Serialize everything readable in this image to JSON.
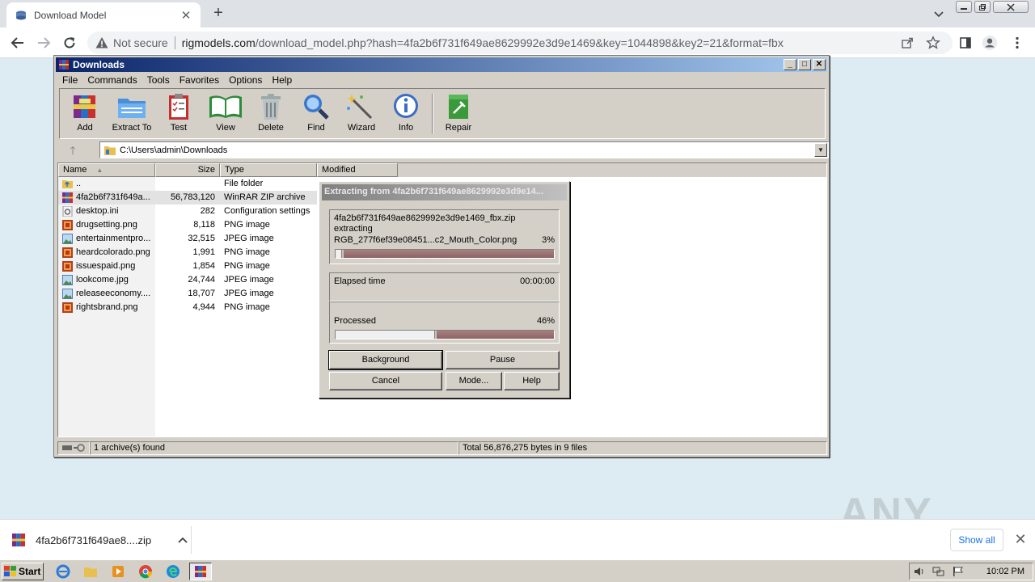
{
  "browser": {
    "tab_title": "Download Model",
    "new_tab": "+",
    "not_secure": "Not secure",
    "url_host": "rigmodels.com",
    "url_path": "/download_model.php?hash=4fa2b6f731f649ae8629992e3d9e1469&key=1044898&key2=21&format=fbx"
  },
  "winrar": {
    "title": "Downloads",
    "menu": [
      "File",
      "Commands",
      "Tools",
      "Favorites",
      "Options",
      "Help"
    ],
    "tools": [
      {
        "label": "Add",
        "icon": "add-archive-icon"
      },
      {
        "label": "Extract To",
        "icon": "extract-folder-icon"
      },
      {
        "label": "Test",
        "icon": "test-clipboard-icon"
      },
      {
        "label": "View",
        "icon": "view-book-icon"
      },
      {
        "label": "Delete",
        "icon": "trash-icon"
      },
      {
        "label": "Find",
        "icon": "magnifier-icon"
      },
      {
        "label": "Wizard",
        "icon": "magic-wand-icon"
      },
      {
        "label": "Info",
        "icon": "info-icon"
      },
      {
        "label": "Repair",
        "icon": "repair-kit-icon"
      }
    ],
    "path": "C:\\Users\\admin\\Downloads",
    "columns": {
      "name": "Name",
      "size": "Size",
      "type": "Type",
      "modified": "Modified"
    },
    "files": [
      {
        "name": "..",
        "size": "",
        "type": "File folder",
        "icon": "parent-folder-icon"
      },
      {
        "name": "4fa2b6f731f649a...",
        "size": "56,783,120",
        "type": "WinRAR ZIP archive",
        "icon": "zip-archive-icon"
      },
      {
        "name": "desktop.ini",
        "size": "282",
        "type": "Configuration settings",
        "icon": "settings-file-icon"
      },
      {
        "name": "drugsetting.png",
        "size": "8,118",
        "type": "PNG image",
        "icon": "png-image-icon"
      },
      {
        "name": "entertainmentpro...",
        "size": "32,515",
        "type": "JPEG image",
        "icon": "jpeg-image-icon"
      },
      {
        "name": "heardcolorado.png",
        "size": "1,991",
        "type": "PNG image",
        "icon": "png-image-icon"
      },
      {
        "name": "issuespaid.png",
        "size": "1,854",
        "type": "PNG image",
        "icon": "png-image-icon"
      },
      {
        "name": "lookcome.jpg",
        "size": "24,744",
        "type": "JPEG image",
        "icon": "jpeg-image-icon"
      },
      {
        "name": "releaseeconomy....",
        "size": "18,707",
        "type": "JPEG image",
        "icon": "jpeg-image-icon"
      },
      {
        "name": "rightsbrand.png",
        "size": "4,944",
        "type": "PNG image",
        "icon": "png-image-icon"
      }
    ],
    "status_left": "1 archive(s) found",
    "status_right": "Total 56,876,275 bytes in 9 files"
  },
  "extract_dialog": {
    "title": "Extracting from 4fa2b6f731f649ae8629992e3d9e14...",
    "archive": "4fa2b6f731f649ae8629992e3d9e1469_fbx.zip",
    "action": "extracting",
    "current_file": "RGB_277f6ef39e08451...c2_Mouth_Color.png",
    "file_percent": "3%",
    "file_progress": 0.03,
    "elapsed_label": "Elapsed time",
    "elapsed_value": "00:00:00",
    "processed_label": "Processed",
    "processed_percent": "46%",
    "processed_progress": 0.46,
    "buttons": {
      "background": "Background",
      "pause": "Pause",
      "cancel": "Cancel",
      "mode": "Mode...",
      "help": "Help"
    }
  },
  "download_shelf": {
    "file": "4fa2b6f731f649ae8....zip",
    "show_all": "Show all"
  },
  "watermark": "ANY RUN",
  "taskbar": {
    "start": "Start",
    "clock": "10:02 PM"
  }
}
